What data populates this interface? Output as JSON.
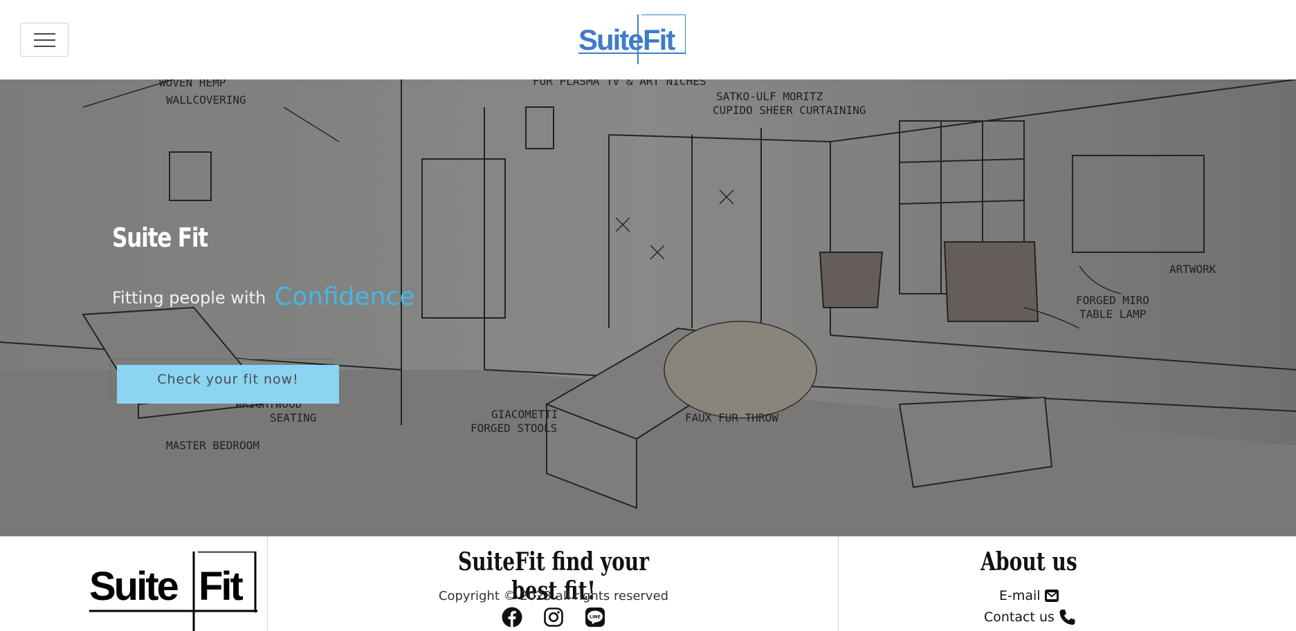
{
  "header": {
    "menu_icon": "hamburger-icon",
    "logo_left": "Suite",
    "logo_right": "Fit",
    "logo_color": "#3d7cc9"
  },
  "hero": {
    "title": "Suite Fit",
    "subtitle": "Fitting people with",
    "accent": "Confidence",
    "accent_color": "#46b6e6",
    "cta_label": "Check your fit now!",
    "cta_color": "#8bd4f2"
  },
  "footer": {
    "logo_left": "Suite",
    "logo_right": "Fit",
    "tagline": "SuiteFit find your best fit!",
    "copyright": "Copyright © 2023 all rights reserved",
    "social_icons": [
      "facebook-icon",
      "instagram-icon",
      "line-icon"
    ],
    "line_text": "LINE",
    "about_title": "About us",
    "email_label": "E-mail",
    "contact_label": "Contact us"
  }
}
